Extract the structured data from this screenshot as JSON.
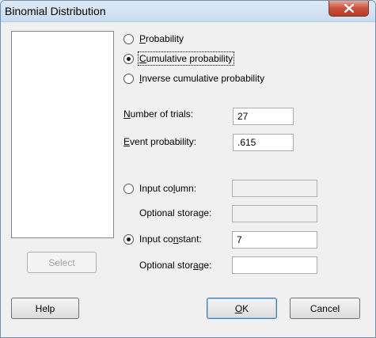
{
  "window": {
    "title": "Binomial Distribution"
  },
  "icons": {
    "close": "close-icon"
  },
  "variables_list": {
    "items": []
  },
  "select_button": {
    "label": "Select",
    "enabled": false
  },
  "modes": {
    "probability": {
      "pre": "",
      "key": "P",
      "post": "robability",
      "checked": false
    },
    "cumulative": {
      "pre": "",
      "key": "C",
      "post": "umulative probability",
      "checked": true
    },
    "inverse": {
      "pre": "",
      "key": "I",
      "post": "nverse cumulative probability",
      "checked": false
    }
  },
  "trials": {
    "pre": "",
    "key": "N",
    "post": "umber of trials:",
    "value": "27"
  },
  "event_prob": {
    "pre": "",
    "key": "E",
    "post": "vent probability:",
    "value": ".615"
  },
  "input_column": {
    "pre": "Input co",
    "key": "l",
    "post": "umn:",
    "checked": false,
    "value": ""
  },
  "optional_storage_1": {
    "label": "Optional storage:",
    "value": ""
  },
  "input_constant": {
    "pre": "Input co",
    "key": "n",
    "post": "stant:",
    "checked": true,
    "value": "7"
  },
  "optional_storage_2": {
    "pre": "Optional stor",
    "key": "a",
    "post": "ge:",
    "value": ""
  },
  "buttons": {
    "help": "Help",
    "ok": {
      "pre": "",
      "key": "O",
      "post": "K"
    },
    "cancel": "Cancel"
  },
  "colors": {
    "window_bg": "#f0f0f0",
    "titlebar": "#c8dcf0",
    "close": "#c9513c"
  }
}
